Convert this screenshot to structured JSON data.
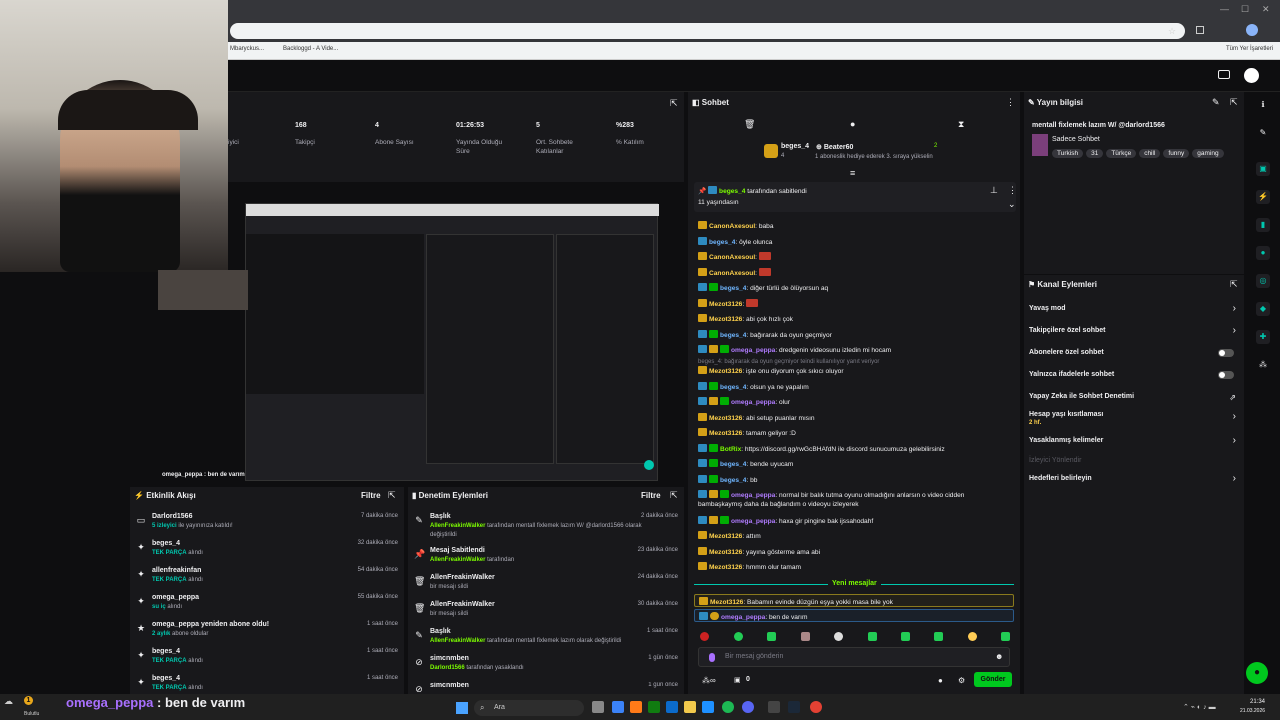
{
  "browser": {
    "bookmarks": [
      "Mbaryckus...",
      "Backloggd - A Vide..."
    ],
    "all_bookmarks": "Tüm Yer İşaretleri"
  },
  "stats": {
    "items": [
      {
        "value": "",
        "label": "iyici"
      },
      {
        "value": "168",
        "label": "Takipçi"
      },
      {
        "value": "4",
        "label": "Abone Sayısı"
      },
      {
        "value": "01:26:53",
        "label": "Yayında Olduğu Süre"
      },
      {
        "value": "5",
        "label": "Ort. Sohbete Katılanlar"
      },
      {
        "value": "%283",
        "label": "% Katılım"
      }
    ]
  },
  "activity": {
    "title": "Etkinlik Akışı",
    "filter": "Filtre",
    "rows": [
      {
        "t1": "Darlord1566",
        "t2a": "5 izleyici",
        "t2b": " ile yayınınıza katıldı!",
        "time": "7 dakika önce"
      },
      {
        "t1": "beges_4",
        "t2a": "TEK PARÇA",
        "t2b": " alındı",
        "time": "32 dakika önce"
      },
      {
        "t1": "allenfreakinfan",
        "t2a": "TEK PARÇA",
        "t2b": " alındı",
        "time": "54 dakika önce"
      },
      {
        "t1": "omega_peppa",
        "t2a": "su iç",
        "t2b": " alındı",
        "time": "55 dakika önce"
      },
      {
        "t1": "omega_peppa yeniden abone oldu!",
        "t2a": "2 aylık",
        "t2b": " abone oldular",
        "time": "1 saat önce"
      },
      {
        "t1": "beges_4",
        "t2a": "TEK PARÇA",
        "t2b": " alındı",
        "time": "1 saat önce"
      },
      {
        "t1": "beges_4",
        "t2a": "TEK PARÇA",
        "t2b": " alındı",
        "time": "1 saat önce"
      }
    ]
  },
  "moderation": {
    "title": "Denetim Eylemleri",
    "filter": "Filtre",
    "rows": [
      {
        "t1": "Başlık",
        "t2a": "AllenFreakinWalker",
        "t2b": " tarafından mentall fixlemek lazım W/ @darlord1566 olarak",
        "t3": "değiştirildi",
        "time": "2 dakika önce"
      },
      {
        "t1": "Mesaj Sabitlendi",
        "t2a": "AllenFreakinWalker",
        "t2b": " tarafından",
        "t3": "",
        "time": "23 dakika önce"
      },
      {
        "t1": "AllenFreakinWalker",
        "t2a": "",
        "t2b": "bir mesajı sildi",
        "t3": "",
        "time": "24 dakika önce"
      },
      {
        "t1": "AllenFreakinWalker",
        "t2a": "",
        "t2b": "bir mesajı sildi",
        "t3": "",
        "time": "30 dakika önce"
      },
      {
        "t1": "Başlık",
        "t2a": "AllenFreakinWalker",
        "t2b": " tarafından mentall fixlemek lazım olarak değiştirildi",
        "t3": "",
        "time": "1 saat önce"
      },
      {
        "t1": "simcnmben",
        "t2a": "Darlord1566",
        "t2b": " tarafından yasaklandı",
        "t3": "",
        "time": "1 gün önce"
      },
      {
        "t1": "simcnmben",
        "t2a": "",
        "t2b": "",
        "t3": "",
        "time": "1 gün önce"
      }
    ]
  },
  "chat": {
    "title": "Sohbet",
    "leader1": "beges_4",
    "leader1_count": "4",
    "leader2": "Beater60",
    "leader2_count": "2",
    "leader_note": "1 aboneslik hediye ederek 3. sıraya yükselin",
    "pinned_by": "beges_4",
    "pinned_suffix": " tarafından sabitlendi",
    "pinned_msg": "11 yaşındasın",
    "messages": [
      {
        "user": "CanonAxesoul",
        "text": "baba",
        "color": "gold",
        "badges": [
          "gold"
        ]
      },
      {
        "user": "beges_4",
        "text": "öyle olunca",
        "color": "blue",
        "badges": [
          "blue"
        ]
      },
      {
        "user": "CanonAxesoul",
        "text": "",
        "color": "gold",
        "badges": [
          "gold"
        ]
      },
      {
        "user": "CanonAxesoul",
        "text": "",
        "color": "gold",
        "badges": [
          "gold"
        ]
      },
      {
        "user": "beges_4",
        "text": "diğer türlü de ölüyorsun aq",
        "color": "blue",
        "badges": [
          "blue",
          "mod"
        ]
      },
      {
        "user": "Mezot3126",
        "text": "",
        "color": "gold",
        "badges": [
          "gold"
        ]
      },
      {
        "user": "Mezot3126",
        "text": "abi çok hızlı çok",
        "color": "gold",
        "badges": [
          "gold"
        ]
      },
      {
        "user": "beges_4",
        "text": "bağırarak da oyun geçmiyor",
        "color": "blue",
        "badges": [
          "blue",
          "mod"
        ]
      },
      {
        "user": "omega_peppa",
        "text": "dredgenin videosunu izledin mi hocam",
        "color": "purple",
        "badges": [
          "blue",
          "gold",
          "mod"
        ]
      },
      {
        "user": "Mezot3126",
        "text": "işte onu diyorum çok sıkıcı oluyor",
        "color": "gold",
        "badges": [
          "gold"
        ]
      },
      {
        "user": "beges_4",
        "text": "olsun ya ne yapalım",
        "color": "blue",
        "badges": [
          "blue",
          "mod"
        ]
      },
      {
        "user": "omega_peppa",
        "text": "olur",
        "color": "purple",
        "badges": [
          "blue",
          "gold",
          "mod"
        ]
      },
      {
        "user": "Mezot3126",
        "text": "abi setup puanlar mısın",
        "color": "gold",
        "badges": [
          "gold"
        ]
      },
      {
        "user": "Mezot3126",
        "text": "tamam geliyor :D",
        "color": "gold",
        "badges": [
          "gold"
        ]
      },
      {
        "user": "BotRix",
        "text": "https://discord.gg/rwGcBHAfdN ile discord sunucumuza gelebilirsiniz",
        "color": "green",
        "badges": [
          "blue",
          "mod"
        ]
      },
      {
        "user": "beges_4",
        "text": "bende uyucam",
        "color": "blue",
        "badges": [
          "blue",
          "mod"
        ]
      },
      {
        "user": "beges_4",
        "text": "bb",
        "color": "blue",
        "badges": [
          "blue",
          "mod"
        ]
      },
      {
        "user": "omega_peppa",
        "text": "normal bir balık tutma oyunu olmadığını anlarsın o video cidden",
        "text2": "bambaşkaymış daha da bağlandım o videoyu izleyerek",
        "color": "purple",
        "badges": [
          "blue",
          "gold",
          "mod"
        ]
      },
      {
        "user": "omega_peppa",
        "text": "haxa gir pingine bak ijssahodahf",
        "color": "purple",
        "badges": [
          "blue",
          "gold",
          "mod"
        ]
      },
      {
        "user": "Mezot3126",
        "text": "attım",
        "color": "gold",
        "badges": [
          "gold"
        ]
      },
      {
        "user": "Mezot3126",
        "text": "yayına gösterme ama abi",
        "color": "gold",
        "badges": [
          "gold"
        ]
      },
      {
        "user": "Mezot3126",
        "text": "hmmm olur tamam",
        "color": "gold",
        "badges": [
          "gold"
        ]
      }
    ],
    "reply_hint": "beges_4: bağırarak da oyun geçmiyor teindi kullanılıyor yanıt veriyor",
    "new_messages": "Yeni mesajlar",
    "new1_user": "Mezot3126",
    "new1_text": "Babamın evinde düzgün eşya yokki masa bile yok",
    "new2_user": "omega_peppa",
    "new2_text": "ben de varım",
    "input_placeholder": "Bir mesaj gönderin",
    "send": "Gönder",
    "points": "0"
  },
  "streaminfo": {
    "title": "Yayın bilgisi",
    "stream_title": "mentall fixlemek lazım W/ @darlord1566",
    "category": "Sadece Sohbet",
    "tags": [
      "Turkish",
      "31",
      "Türkçe",
      "chill",
      "funny",
      "gaming"
    ]
  },
  "channel_actions": {
    "title": "Kanal Eylemleri",
    "items": [
      "Yavaş mod",
      "Takipçilere özel sohbet",
      "Abonelere özel sohbet",
      "Yalnızca ifadelerle sohbet",
      "Yapay Zeka ile Sohbet Denetimi",
      "Hesap yaşı kısıtlaması",
      "Yasaklanmış kelimeler",
      "İzleyici Yönlendir",
      "Hedefleri belirleyin"
    ],
    "age_sub": "2 hf."
  },
  "overlay": {
    "user": "omega_peppa",
    "text": " : ben de varım",
    "weather": "Bulutlu",
    "preview_chat": "omega_peppa : ben de varım"
  },
  "taskbar": {
    "search": "Ara",
    "time": "21:34",
    "date": "21.03.2026"
  }
}
